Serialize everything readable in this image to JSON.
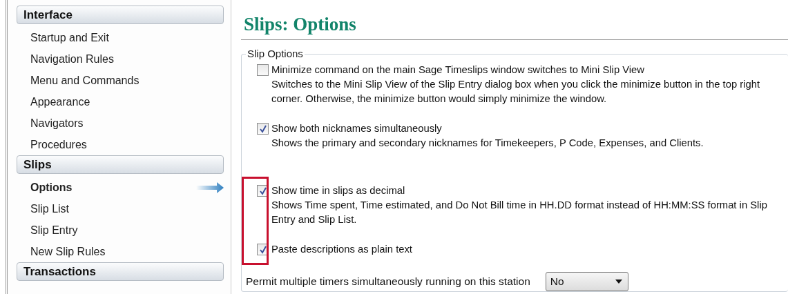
{
  "sidebar": {
    "sections": [
      {
        "title": "Interface",
        "items": [
          {
            "label": "Startup and Exit",
            "selected": false
          },
          {
            "label": "Navigation Rules",
            "selected": false
          },
          {
            "label": "Menu and Commands",
            "selected": false
          },
          {
            "label": "Appearance",
            "selected": false
          },
          {
            "label": "Navigators",
            "selected": false
          },
          {
            "label": "Procedures",
            "selected": false
          }
        ]
      },
      {
        "title": "Slips",
        "items": [
          {
            "label": "Options",
            "selected": true
          },
          {
            "label": "Slip List",
            "selected": false
          },
          {
            "label": "Slip Entry",
            "selected": false
          },
          {
            "label": "New Slip Rules",
            "selected": false
          }
        ]
      },
      {
        "title": "Transactions"
      }
    ]
  },
  "page": {
    "title": "Slips: Options",
    "group": {
      "legend": "Slip Options",
      "options": [
        {
          "label": "Minimize command on the main Sage Timeslips window switches to Mini Slip View",
          "description": "Switches to the Mini Slip View of the Slip Entry dialog box when you click the minimize button in the top right corner. Otherwise, the minimize button would simply minimize the window.",
          "checked": false,
          "highlighted": false
        },
        {
          "label": "Show both nicknames simultaneously",
          "description": "Shows the primary and secondary nicknames for Timekeepers, P Code, Expenses, and Clients.",
          "checked": true,
          "highlighted": false
        },
        {
          "label": "Show time in slips as decimal",
          "description": "Shows Time spent, Time estimated, and Do Not Bill time in HH.DD format instead of HH:MM:SS format in Slip Entry and Slip List.",
          "checked": true,
          "highlighted": true
        },
        {
          "label": "Paste descriptions as plain text",
          "checked": true,
          "highlighted": true
        }
      ],
      "select": {
        "label": "Permit multiple timers simultaneously running on this station",
        "value": "No"
      }
    }
  }
}
